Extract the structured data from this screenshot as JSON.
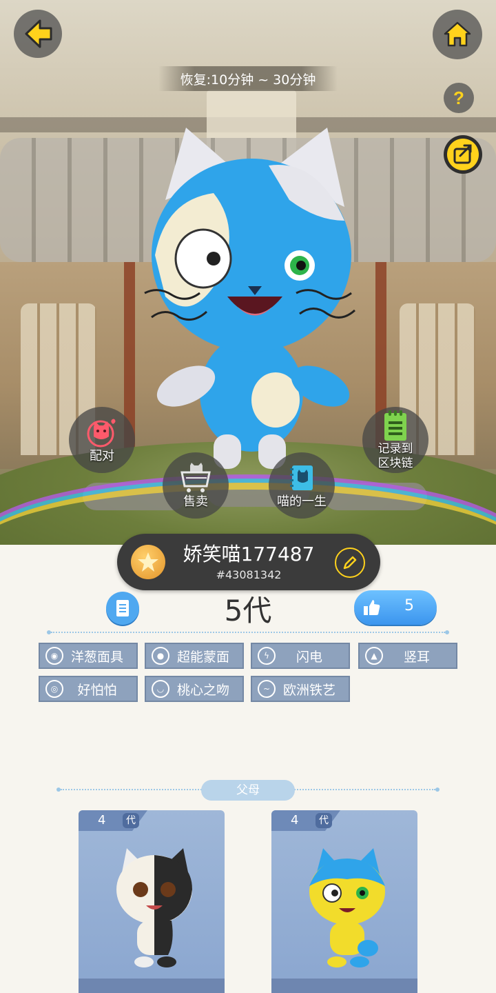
{
  "header": {
    "recover_text": "恢复:10分钟 ~ 30分钟"
  },
  "icons": {
    "back": "arrow-left-icon",
    "home": "home-icon",
    "help": "question-icon",
    "share": "share-icon"
  },
  "help_glyph": "?",
  "actions": {
    "pair": "配对",
    "sell": "售卖",
    "life": "喵的一生",
    "record_line1": "记录到",
    "record_line2": "区块链"
  },
  "cat": {
    "name": "娇笑喵177487",
    "id": "#43081342",
    "generation": "5代",
    "likes": "5"
  },
  "traits": [
    {
      "label": "洋葱面具"
    },
    {
      "label": "超能蒙面"
    },
    {
      "label": "闪电"
    },
    {
      "label": "竖耳"
    },
    {
      "label": "好怕怕"
    },
    {
      "label": "桃心之吻"
    },
    {
      "label": "欧洲铁艺"
    }
  ],
  "parents": {
    "title": "父母",
    "cards": [
      {
        "generation_number": "4",
        "generation_char": "代"
      },
      {
        "generation_number": "4",
        "generation_char": "代"
      }
    ]
  },
  "colors": {
    "accent_yellow": "#ffd21c",
    "cat_blue": "#2fa4ea",
    "trait_bg": "#8ea2bd",
    "like_blue": "#3b95ee"
  }
}
